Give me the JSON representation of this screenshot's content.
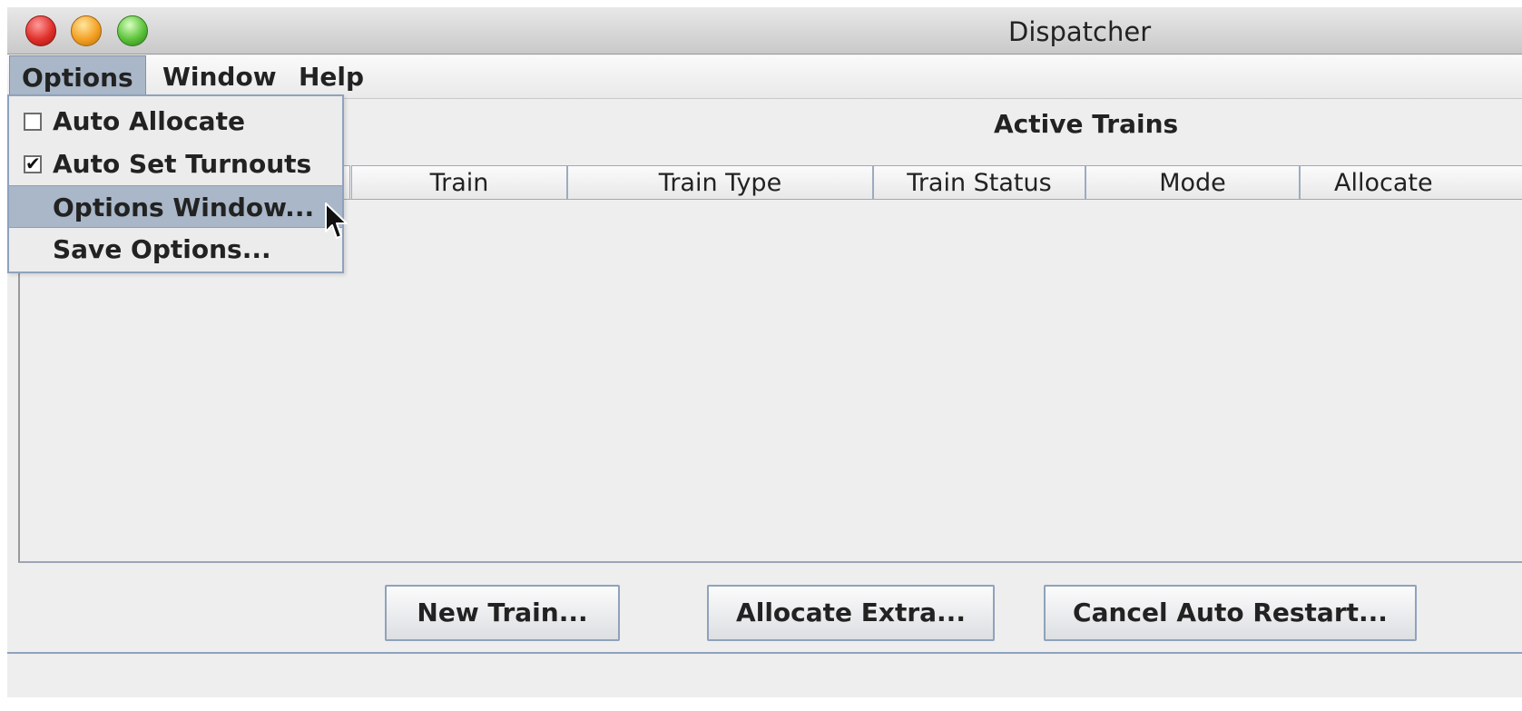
{
  "window": {
    "title": "Dispatcher"
  },
  "menubar": {
    "items": [
      {
        "label": "Options"
      },
      {
        "label": "Window"
      },
      {
        "label": "Help"
      }
    ]
  },
  "options_menu": {
    "items": [
      {
        "label": "Auto Allocate",
        "type": "checkbox",
        "checked": false
      },
      {
        "label": "Auto Set Turnouts",
        "type": "checkbox",
        "checked": true
      },
      {
        "label": "Options Window...",
        "type": "action",
        "highlighted": true
      },
      {
        "label": "Save Options...",
        "type": "action"
      }
    ],
    "checked_mark": "✔"
  },
  "main": {
    "section_title": "Active Trains",
    "table": {
      "columns": [
        "",
        "Train",
        "Train Type",
        "Train Status",
        "Mode",
        "Allocate"
      ]
    },
    "buttons": {
      "new_train": "New Train...",
      "allocate_extra": "Allocate Extra...",
      "cancel_auto_restart": "Cancel Auto Restart..."
    }
  },
  "colors": {
    "selection": "#a9b7c8",
    "border_blue": "#8ea2bd"
  },
  "icons": {
    "close": "close-traffic-light",
    "minimize": "minimize-traffic-light",
    "zoom": "zoom-traffic-light",
    "cursor": "arrow-cursor-icon"
  }
}
